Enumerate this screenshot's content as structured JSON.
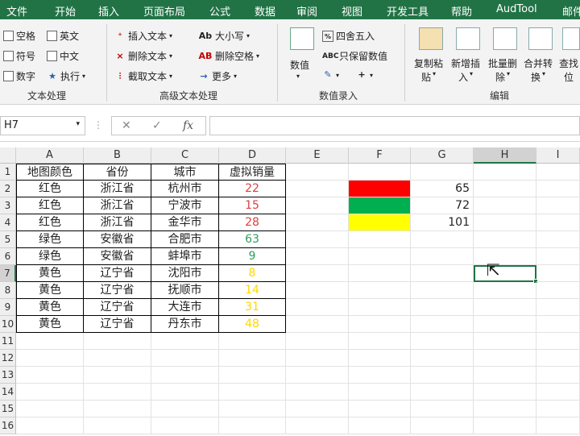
{
  "menu": {
    "tabs": [
      "文件",
      "开始",
      "插入",
      "页面布局",
      "公式",
      "数据",
      "审阅",
      "视图",
      "开发工具",
      "帮助",
      "AudTool",
      "邮件"
    ]
  },
  "ribbon": {
    "check_items": [
      "空格",
      "英文",
      "符号",
      "中文",
      "数字"
    ],
    "exec_label": "执行",
    "text_ops": [
      "插入文本",
      "删除文本",
      "截取文本"
    ],
    "case_label": "大小写",
    "remove_space_label": "删除空格",
    "more_label": "更多",
    "value_label": "数值",
    "round_label": "四舍五入",
    "keep_value_label": "只保留数值",
    "big_buttons": [
      {
        "line1": "复制粘",
        "line2": "贴"
      },
      {
        "line1": "新增插",
        "line2": "入"
      },
      {
        "line1": "批量删",
        "line2": "除"
      },
      {
        "line1": "合并转",
        "line2": "换"
      },
      {
        "line1": "查找",
        "line2": "位"
      }
    ],
    "groups": [
      "文本处理",
      "高级文本处理",
      "数值录入",
      "编辑"
    ]
  },
  "formula_bar": {
    "name_box": "H7",
    "cancel": "✕",
    "enter": "✓",
    "fx": "fx",
    "content": ""
  },
  "columns": [
    "A",
    "B",
    "C",
    "D",
    "E",
    "F",
    "G",
    "H",
    "I"
  ],
  "rows": [
    "1",
    "2",
    "3",
    "4",
    "5",
    "6",
    "7",
    "8",
    "9",
    "10",
    "11",
    "12",
    "13",
    "14",
    "15",
    "16"
  ],
  "table": {
    "headers": [
      "地图颜色",
      "省份",
      "城市",
      "虚拟销量"
    ],
    "rows": [
      [
        "红色",
        "浙江省",
        "杭州市",
        "22"
      ],
      [
        "红色",
        "浙江省",
        "宁波市",
        "15"
      ],
      [
        "红色",
        "浙江省",
        "金华市",
        "28"
      ],
      [
        "绿色",
        "安徽省",
        "合肥市",
        "63"
      ],
      [
        "绿色",
        "安徽省",
        "蚌埠市",
        "9"
      ],
      [
        "黄色",
        "辽宁省",
        "沈阳市",
        "8"
      ],
      [
        "黄色",
        "辽宁省",
        "抚顺市",
        "14"
      ],
      [
        "黄色",
        "辽宁省",
        "大连市",
        "31"
      ],
      [
        "黄色",
        "辽宁省",
        "丹东市",
        "48"
      ]
    ]
  },
  "colors": {
    "red": "#ff0000",
    "green": "#00b050",
    "yellow": "#ffff00",
    "red_text": "#e04040",
    "green_text": "#2e9e5c",
    "yellow_text": "#ffd700",
    "accent": "#217346"
  },
  "swatch_values": [
    "65",
    "72",
    "101"
  ],
  "active_cell": "H7"
}
